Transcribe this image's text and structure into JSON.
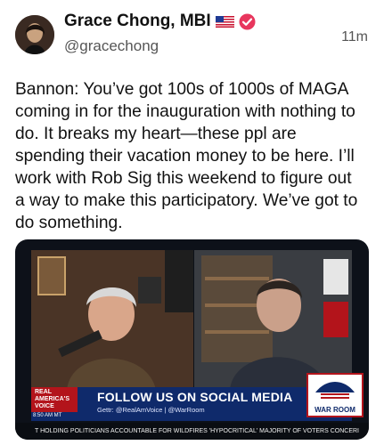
{
  "user": {
    "display_name": "Grace Chong, MBI",
    "handle": "@gracechong",
    "flag_icon": "us-flag-icon",
    "verified_icon": "verified-badge-icon"
  },
  "post": {
    "timestamp": "11m",
    "lines": [
      "Bannon: You’ve got 100s of 1000s of MAGA",
      "coming in for the inauguration with nothing to",
      "do. It breaks my heart—these ppl are",
      "spending their vacation money to be here. I’ll",
      "work with Rob Sig this weekend to figure out",
      "a way to make this participatory. We’ve got to",
      "do something."
    ]
  },
  "media": {
    "badge": "REAL AMERICA'S VOICE",
    "banner_title": "FOLLOW US ON SOCIAL MEDIA",
    "banner_sub": "Gettr: @RealAmVoice | @WarRoom",
    "time": "8:50 AM MT",
    "logo": "WAR ROOM",
    "ticker": "T HOLDING POLITICIANS ACCOUNTABLE FOR WILDFIRES 'HYPOCRITICAL'    MAJORITY OF VOTERS CONCERI",
    "colors": {
      "banner": "#0f2a6b",
      "accent": "#b3141b"
    }
  }
}
